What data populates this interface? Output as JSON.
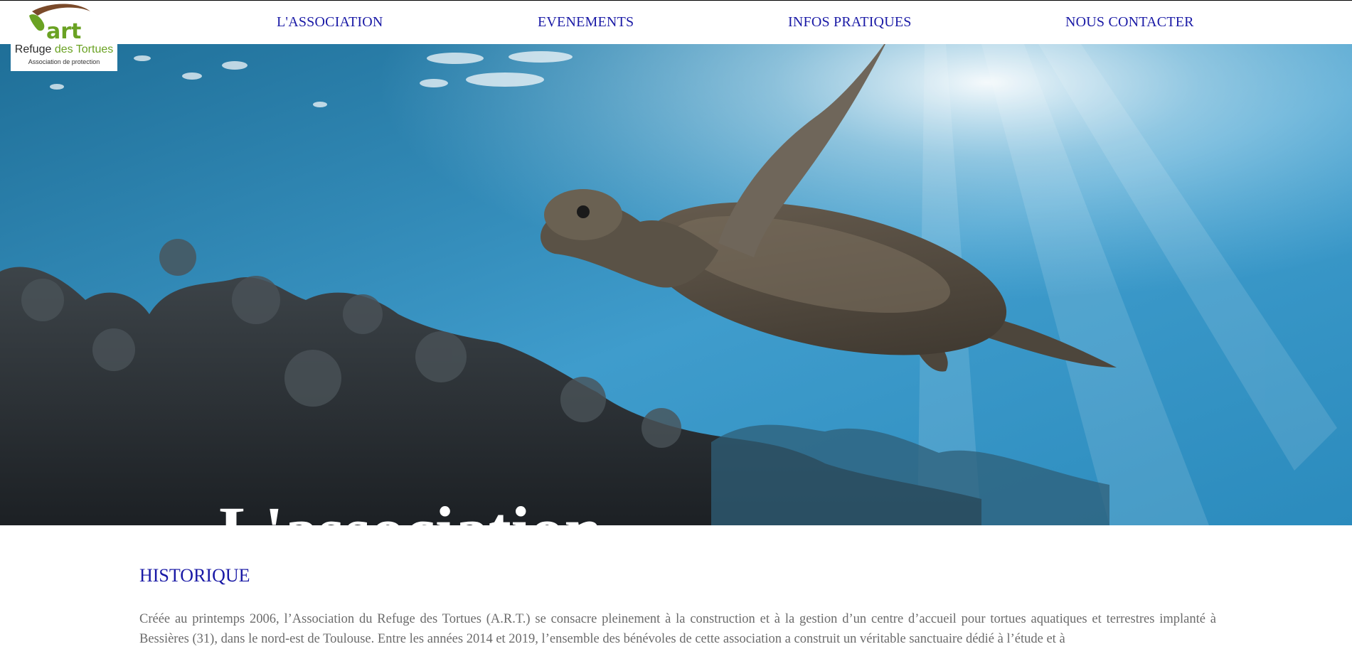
{
  "nav": {
    "items": [
      {
        "label": "L'ASSOCIATION"
      },
      {
        "label": "EVENEMENTS"
      },
      {
        "label": "INFOS PRATIQUES"
      },
      {
        "label": "NOUS CONTACTER"
      }
    ]
  },
  "logo": {
    "mark": "art",
    "name_part1": "Refuge ",
    "name_part2": "des Tortues",
    "tagline": "Association de protection"
  },
  "hero": {
    "title": "L'association",
    "image": "sea-turtle-underwater-photo"
  },
  "historique": {
    "heading": "HISTORIQUE",
    "text": "Créée au printemps 2006, l’Association du Refuge des Tortues (A.R.T.) se consacre pleinement à la construction et à la gestion d’un centre d’accueil pour tortues aquatiques et terrestres implanté à Bessières (31), dans le nord-est de Toulouse. Entre les années 2014 et 2019, l’ensemble des bénévoles de cette association a construit un véritable sanctuaire dédié à l’étude et à"
  },
  "colors": {
    "nav_link": "#1a1aa6",
    "heading": "#1a1aa6",
    "body_text": "#6b6b6b",
    "logo_green": "#6aa223",
    "logo_brown": "#7a4a2a"
  }
}
